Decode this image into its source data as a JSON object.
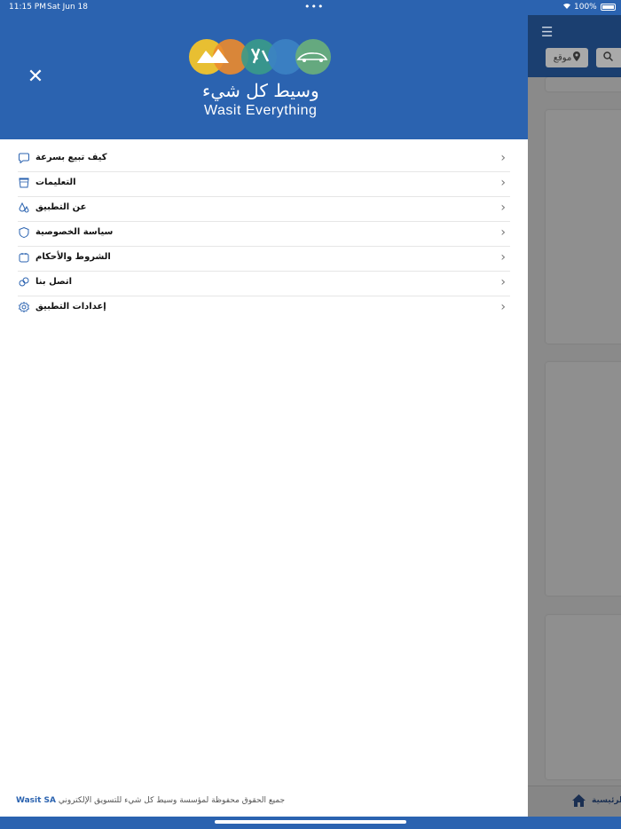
{
  "status_bar": {
    "time": "11:15 PM",
    "date": "Sat Jun 18",
    "dots": "•••",
    "battery": "100%"
  },
  "drawer": {
    "logo": {
      "arabic": "وسيط كل شيء",
      "english": "Wasit Everything",
      "colors": [
        "#f2c42b",
        "#ec8a2c",
        "#3a9a8a",
        "#3c82c4",
        "#6bb07a"
      ]
    },
    "menu": [
      {
        "label": "كيف تبيع بسرعة",
        "icon": "chat-bubble-icon"
      },
      {
        "label": "التعليمات",
        "icon": "trash-basket-icon"
      },
      {
        "label": "عن التطبيق",
        "icon": "drops-icon"
      },
      {
        "label": "سياسة الخصوصية",
        "icon": "shield-icon"
      },
      {
        "label": "الشروط والأحكام",
        "icon": "calendar-icon"
      },
      {
        "label": "اتصل بنا",
        "icon": "contact-bubbles-icon"
      },
      {
        "label": "إعدادات التطبيق",
        "icon": "settings-gear-icon"
      }
    ],
    "footer": {
      "brand": "Wasit SA",
      "text": "جميع الحقوق محفوظة لمؤسسة وسيط كل شيء للتسويق الإلكتروني"
    }
  },
  "background_app": {
    "location_label": "موقع",
    "home_label": "الرئيسية"
  },
  "colors": {
    "primary": "#2b63b0",
    "overlay": "#8a8a8a",
    "dark_header": "#1b3f70"
  }
}
